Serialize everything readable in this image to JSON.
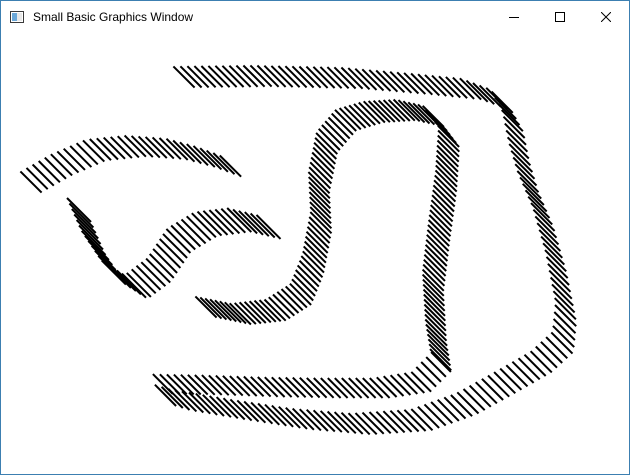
{
  "window": {
    "title": "Small Basic Graphics Window",
    "icon": "app-icon",
    "controls": [
      "minimize-icon",
      "maximize-icon",
      "close-icon"
    ],
    "accent_color": "#3c7fb1"
  },
  "canvas": {
    "background": "#ffffff",
    "stroke_color": "#000000",
    "content": "hatched track drawing"
  }
}
